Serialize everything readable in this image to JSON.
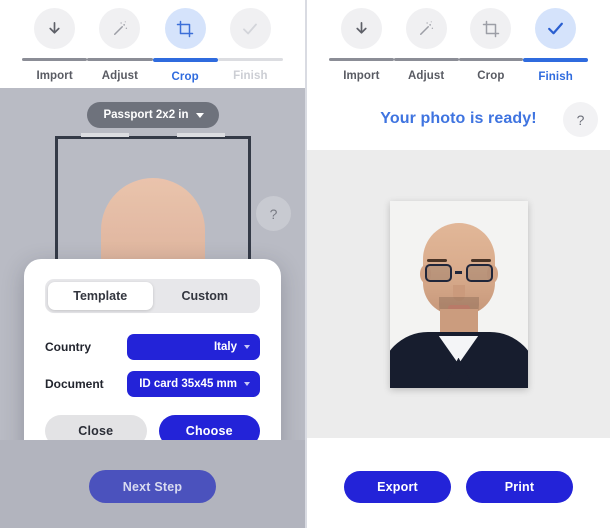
{
  "left": {
    "steps": [
      {
        "label": "Import",
        "icon": "download-arrow-icon",
        "state": "done"
      },
      {
        "label": "Adjust",
        "icon": "magic-wand-icon",
        "state": "done"
      },
      {
        "label": "Crop",
        "icon": "crop-icon",
        "state": "active"
      },
      {
        "label": "Finish",
        "icon": "check-icon",
        "state": "dim"
      }
    ],
    "format_chip": "Passport 2x2 in",
    "help_label": "?",
    "next_button": "Next Step"
  },
  "modal": {
    "tabs": [
      {
        "label": "Template",
        "selected": true
      },
      {
        "label": "Custom",
        "selected": false
      }
    ],
    "fields": [
      {
        "label": "Country",
        "value": "Italy"
      },
      {
        "label": "Document",
        "value": "ID card 35x45 mm"
      }
    ],
    "close_button": "Close",
    "choose_button": "Choose"
  },
  "right": {
    "steps": [
      {
        "label": "Import",
        "icon": "download-arrow-icon",
        "state": "done"
      },
      {
        "label": "Adjust",
        "icon": "magic-wand-icon",
        "state": "done"
      },
      {
        "label": "Crop",
        "icon": "crop-icon",
        "state": "done"
      },
      {
        "label": "Finish",
        "icon": "check-icon",
        "state": "active"
      }
    ],
    "title": "Your photo is ready!",
    "help_label": "?",
    "export_button": "Export",
    "print_button": "Print"
  },
  "colors": {
    "accent_blue": "#2323d8",
    "step_blue": "#2f6bde",
    "title_blue": "#3f74e0",
    "next_button": "#4b52bd",
    "editor_gray": "#b2b4be",
    "preview_gray": "#ececec"
  }
}
